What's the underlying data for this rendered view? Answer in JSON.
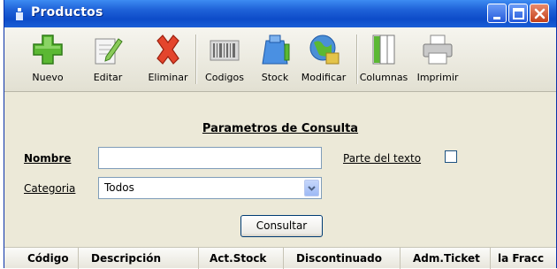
{
  "window": {
    "title": "Productos"
  },
  "toolbar": {
    "nuevo": "Nuevo",
    "editar": "Editar",
    "eliminar": "Eliminar",
    "codigos": "Codigos",
    "stock": "Stock",
    "modificar": "Modificar",
    "columnas": "Columnas",
    "imprimir": "Imprimir"
  },
  "form": {
    "title": "Parametros de Consulta",
    "nombre_label": "Nombre",
    "nombre_value": "",
    "parte_label": "Parte del texto",
    "categoria_label": "Categoria",
    "categoria_value": "Todos",
    "consultar_label": "Consultar"
  },
  "grid": {
    "columns": [
      "Código",
      "Descripción",
      "Act.Stock",
      "Discontinuado",
      "Adm.Ticket",
      "la Fracc"
    ]
  },
  "colors": {
    "titlebar": "#0d4cc9",
    "window_bg": "#ece9d8",
    "close_button": "#c4401a"
  },
  "icons": [
    "app-icon",
    "minimize-icon",
    "maximize-icon",
    "close-icon",
    "plus-icon",
    "edit-icon",
    "delete-icon",
    "barcode-icon",
    "stock-icon",
    "modify-icon",
    "columns-icon",
    "printer-icon",
    "dropdown-arrow-icon"
  ]
}
